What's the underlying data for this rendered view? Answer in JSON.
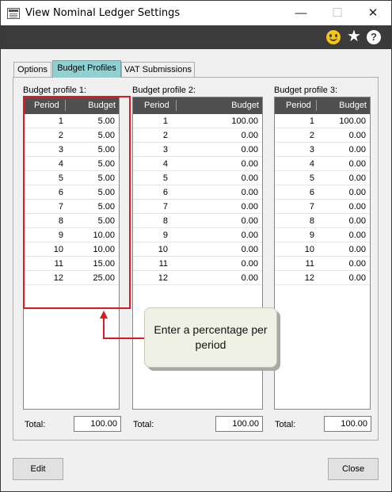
{
  "window": {
    "title": "View Nominal Ledger Settings",
    "controls": {
      "minimize": "—",
      "maximize": "☐",
      "close": "✕"
    }
  },
  "toolbar": {
    "icons": [
      "smiley-icon",
      "star-icon",
      "help-icon"
    ],
    "help_glyph": "?",
    "star_glyph": "★"
  },
  "tabs": [
    {
      "label": "Options",
      "active": false
    },
    {
      "label": "Budget Profiles",
      "active": true
    },
    {
      "label": "VAT Submissions",
      "active": false
    }
  ],
  "profiles": [
    {
      "label": "Budget profile 1:",
      "period_header": "Period",
      "budget_header": "Budget",
      "rows": [
        [
          "1",
          "5.00"
        ],
        [
          "2",
          "5.00"
        ],
        [
          "3",
          "5.00"
        ],
        [
          "4",
          "5.00"
        ],
        [
          "5",
          "5.00"
        ],
        [
          "6",
          "5.00"
        ],
        [
          "7",
          "5.00"
        ],
        [
          "8",
          "5.00"
        ],
        [
          "9",
          "10.00"
        ],
        [
          "10",
          "10.00"
        ],
        [
          "11",
          "15.00"
        ],
        [
          "12",
          "25.00"
        ]
      ],
      "total_label": "Total:",
      "total": "100.00"
    },
    {
      "label": "Budget profile 2:",
      "period_header": "Period",
      "budget_header": "Budget",
      "rows": [
        [
          "1",
          "100.00"
        ],
        [
          "2",
          "0.00"
        ],
        [
          "3",
          "0.00"
        ],
        [
          "4",
          "0.00"
        ],
        [
          "5",
          "0.00"
        ],
        [
          "6",
          "0.00"
        ],
        [
          "7",
          "0.00"
        ],
        [
          "8",
          "0.00"
        ],
        [
          "9",
          "0.00"
        ],
        [
          "10",
          "0.00"
        ],
        [
          "11",
          "0.00"
        ],
        [
          "12",
          "0.00"
        ]
      ],
      "total_label": "Total:",
      "total": "100.00"
    },
    {
      "label": "Budget profile 3:",
      "period_header": "Period",
      "budget_header": "Budget",
      "rows": [
        [
          "1",
          "100.00"
        ],
        [
          "2",
          "0.00"
        ],
        [
          "3",
          "0.00"
        ],
        [
          "4",
          "0.00"
        ],
        [
          "5",
          "0.00"
        ],
        [
          "6",
          "0.00"
        ],
        [
          "7",
          "0.00"
        ],
        [
          "8",
          "0.00"
        ],
        [
          "9",
          "0.00"
        ],
        [
          "10",
          "0.00"
        ],
        [
          "11",
          "0.00"
        ],
        [
          "12",
          "0.00"
        ]
      ],
      "total_label": "Total:",
      "total": "100.00"
    }
  ],
  "annotation": {
    "callout_text": "Enter a percentage per period",
    "highlight_color": "#e0191f"
  },
  "footer": {
    "edit_label": "Edit",
    "close_label": "Close"
  },
  "colors": {
    "toolbar_bg": "#3b3b3b",
    "active_tab": "#8fd1d2",
    "list_header": "#505050",
    "smiley": "#f5c518"
  }
}
